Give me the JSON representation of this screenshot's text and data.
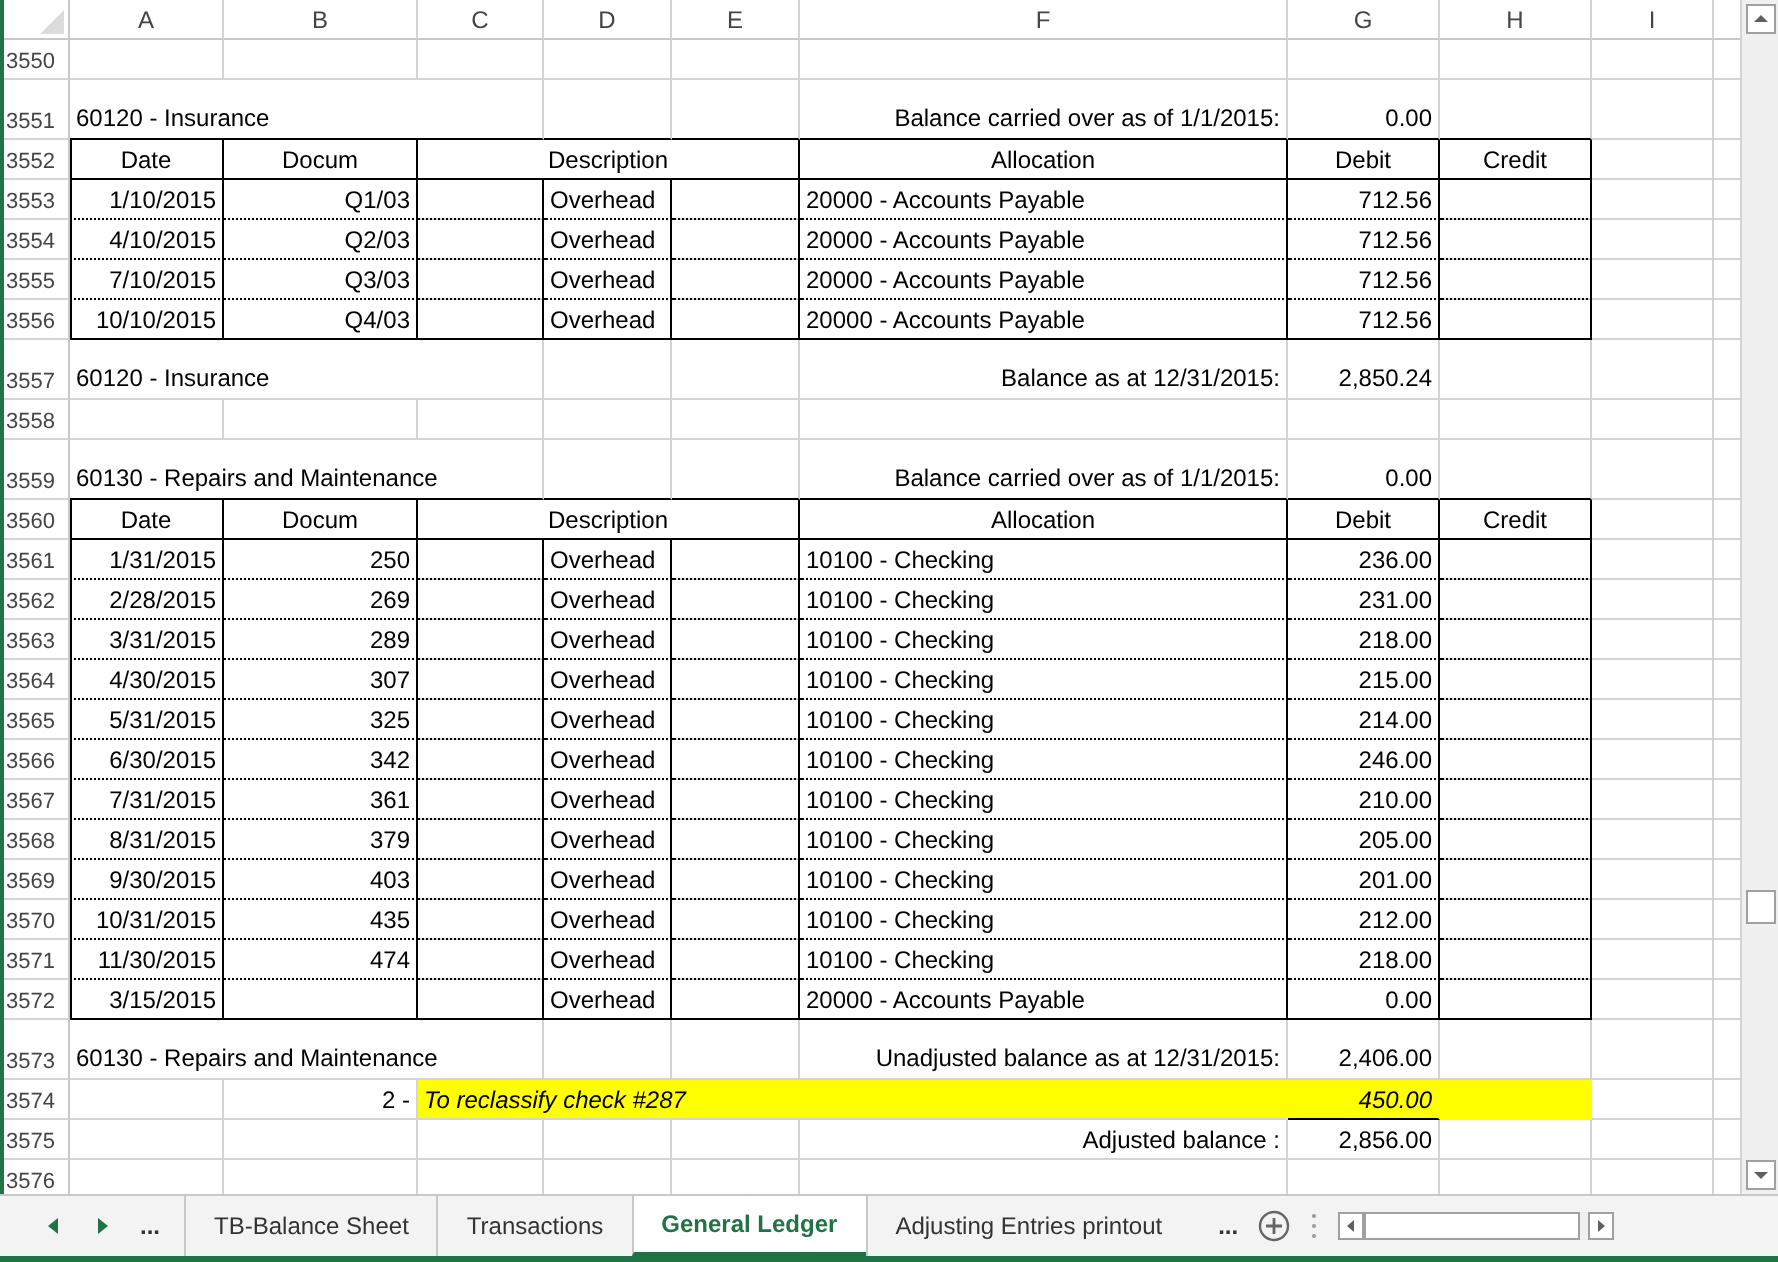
{
  "columns": [
    "A",
    "B",
    "C",
    "D",
    "E",
    "F",
    "G",
    "H",
    "I"
  ],
  "rows": [
    {
      "number": "3550",
      "kind": "blank"
    },
    {
      "number": "3551",
      "kind": "title",
      "account": "60120 - Insurance",
      "label": "Balance carried over as of 1/1/2015:",
      "amount": "0.00"
    },
    {
      "number": "3552",
      "kind": "header",
      "cells": [
        "Date",
        "Docum",
        "Description",
        "Allocation",
        "Debit",
        "Credit"
      ]
    },
    {
      "number": "3553",
      "kind": "entry",
      "date": "1/10/2015",
      "document": "Q1/03",
      "description": "Overhead",
      "allocation": "20000 - Accounts Payable",
      "debit": "712.56"
    },
    {
      "number": "3554",
      "kind": "entry",
      "date": "4/10/2015",
      "document": "Q2/03",
      "description": "Overhead",
      "allocation": "20000 - Accounts Payable",
      "debit": "712.56"
    },
    {
      "number": "3555",
      "kind": "entry",
      "date": "7/10/2015",
      "document": "Q3/03",
      "description": "Overhead",
      "allocation": "20000 - Accounts Payable",
      "debit": "712.56"
    },
    {
      "number": "3556",
      "kind": "entry",
      "date": "10/10/2015",
      "document": "Q4/03",
      "description": "Overhead",
      "allocation": "20000 - Accounts Payable",
      "debit": "712.56"
    },
    {
      "number": "3557",
      "kind": "title",
      "account": "60120 - Insurance",
      "label": "Balance as at 12/31/2015:",
      "amount": "2,850.24"
    },
    {
      "number": "3558",
      "kind": "blank"
    },
    {
      "number": "3559",
      "kind": "title",
      "account": "60130 - Repairs and Maintenance",
      "label": "Balance carried over as of 1/1/2015:",
      "amount": "0.00"
    },
    {
      "number": "3560",
      "kind": "header",
      "cells": [
        "Date",
        "Docum",
        "Description",
        "Allocation",
        "Debit",
        "Credit"
      ]
    },
    {
      "number": "3561",
      "kind": "entry",
      "date": "1/31/2015",
      "document": "250",
      "description": "Overhead",
      "allocation": "10100 - Checking",
      "debit": "236.00"
    },
    {
      "number": "3562",
      "kind": "entry",
      "date": "2/28/2015",
      "document": "269",
      "description": "Overhead",
      "allocation": "10100 - Checking",
      "debit": "231.00"
    },
    {
      "number": "3563",
      "kind": "entry",
      "date": "3/31/2015",
      "document": "289",
      "description": "Overhead",
      "allocation": "10100 - Checking",
      "debit": "218.00"
    },
    {
      "number": "3564",
      "kind": "entry",
      "date": "4/30/2015",
      "document": "307",
      "description": "Overhead",
      "allocation": "10100 - Checking",
      "debit": "215.00"
    },
    {
      "number": "3565",
      "kind": "entry",
      "date": "5/31/2015",
      "document": "325",
      "description": "Overhead",
      "allocation": "10100 - Checking",
      "debit": "214.00"
    },
    {
      "number": "3566",
      "kind": "entry",
      "date": "6/30/2015",
      "document": "342",
      "description": "Overhead",
      "allocation": "10100 - Checking",
      "debit": "246.00"
    },
    {
      "number": "3567",
      "kind": "entry",
      "date": "7/31/2015",
      "document": "361",
      "description": "Overhead",
      "allocation": "10100 - Checking",
      "debit": "210.00"
    },
    {
      "number": "3568",
      "kind": "entry",
      "date": "8/31/2015",
      "document": "379",
      "description": "Overhead",
      "allocation": "10100 - Checking",
      "debit": "205.00"
    },
    {
      "number": "3569",
      "kind": "entry",
      "date": "9/30/2015",
      "document": "403",
      "description": "Overhead",
      "allocation": "10100 - Checking",
      "debit": "201.00"
    },
    {
      "number": "3570",
      "kind": "entry",
      "date": "10/31/2015",
      "document": "435",
      "description": "Overhead",
      "allocation": "10100 - Checking",
      "debit": "212.00"
    },
    {
      "number": "3571",
      "kind": "entry",
      "date": "11/30/2015",
      "document": "474",
      "description": "Overhead",
      "allocation": "10100 - Checking",
      "debit": "218.00"
    },
    {
      "number": "3572",
      "kind": "entry",
      "date": "3/15/2015",
      "description": "Overhead",
      "allocation": "20000 - Accounts Payable",
      "debit": "0.00"
    },
    {
      "number": "3573",
      "kind": "title",
      "account": "60130 - Repairs and Maintenance",
      "label": "Unadjusted balance as at 12/31/2015:",
      "amount": "2,406.00"
    },
    {
      "number": "3574",
      "kind": "adjustment",
      "reference": "2 -",
      "memo": "To reclassify check #287",
      "amount": "450.00"
    },
    {
      "number": "3575",
      "kind": "adjusted",
      "label": "Adjusted balance :",
      "amount": "2,856.00"
    },
    {
      "number": "3576",
      "kind": "blank"
    }
  ],
  "sheet_tabs": {
    "more_left": "...",
    "more_right": "...",
    "tabs": [
      {
        "label": "TB-Balance Sheet",
        "selected": false
      },
      {
        "label": "Transactions",
        "selected": false
      },
      {
        "label": "General Ledger",
        "selected": true
      },
      {
        "label": "Adjusting Entries printout",
        "selected": false
      }
    ]
  }
}
